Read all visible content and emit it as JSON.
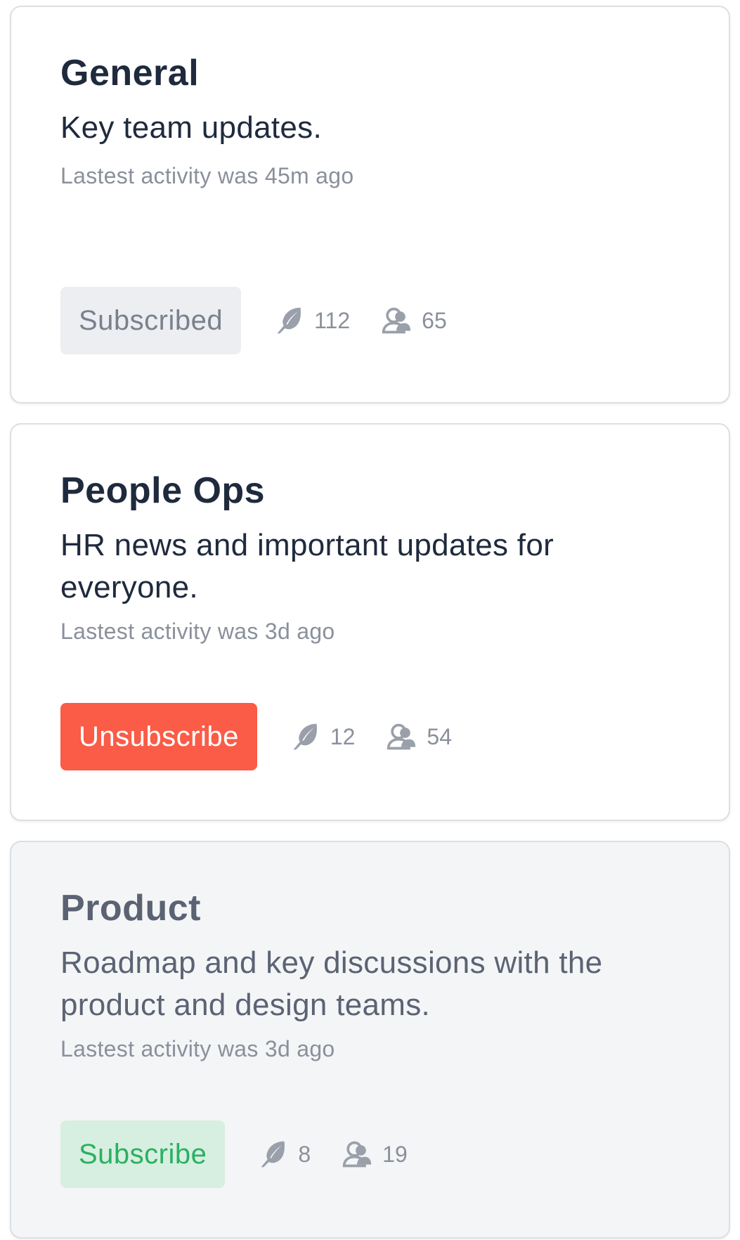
{
  "colors": {
    "title": "#1f2a3d",
    "muted_text": "#8a909b",
    "subscribed_bg": "#eceef1",
    "unsubscribe_bg": "#fa5c47",
    "subscribe_bg": "#d7efe0",
    "subscribe_text": "#2bb062"
  },
  "channels": [
    {
      "title": "General",
      "description": "Key team updates.",
      "activity": "Lastest activity was 45m ago",
      "button_label": "Subscribed",
      "button_state": "subscribed",
      "posts": "112",
      "members": "65",
      "posts_icon": "feather-icon",
      "members_icon": "users-icon"
    },
    {
      "title": "People Ops",
      "description": "HR news and important updates for everyone.",
      "activity": "Lastest activity was 3d ago",
      "button_label": "Unsubscribe",
      "button_state": "unsubscribe",
      "posts": "12",
      "members": "54",
      "posts_icon": "feather-icon",
      "members_icon": "users-icon"
    },
    {
      "title": "Product",
      "description": "Roadmap and key discussions with the product and design teams.",
      "activity": "Lastest activity was 3d ago",
      "button_label": "Subscribe",
      "button_state": "subscribe",
      "posts": "8",
      "members": "19",
      "posts_icon": "feather-icon",
      "members_icon": "users-icon"
    }
  ]
}
